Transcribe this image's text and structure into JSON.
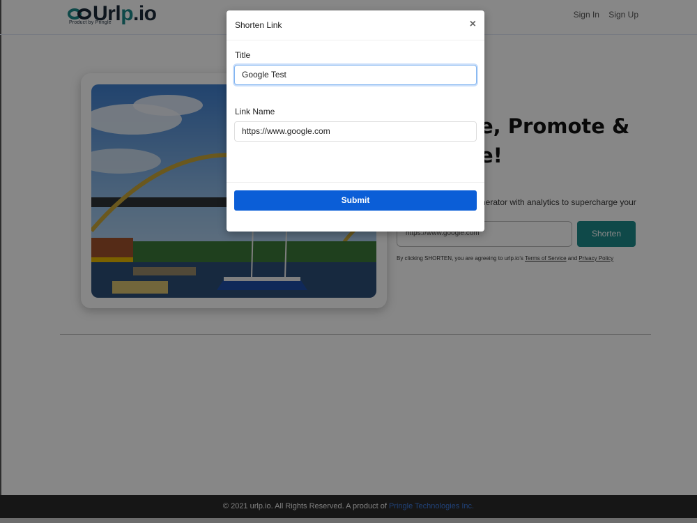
{
  "logo": {
    "name": "Urlp.io",
    "name_main": "Url",
    "name_p": "p",
    "name_tld": ".io",
    "subtitle": "Product by Pringle"
  },
  "nav": {
    "sign_in": "Sign In",
    "sign_up": "Sign Up"
  },
  "hero": {
    "headline_line1": "e, Promote &",
    "headline_line2": "e!",
    "tagline": "nerator with analytics to supercharge your",
    "url_value": "https://www.google.com",
    "shorten_label": "Shorten",
    "legal_prefix": "By clicking SHORTEN, you are agreeing to urlp.io's",
    "terms_label": "Terms of Service",
    "and_label": "and",
    "privacy_label": "Privacy Policy"
  },
  "footer": {
    "text": "© 2021 urlp.io. All Rights Reserved. A product of",
    "link_label": "Pringle Technologies Inc."
  },
  "modal": {
    "title": "Shorten Link",
    "close_symbol": "×",
    "title_label": "Title",
    "title_value": "Google Test",
    "link_label": "Link Name",
    "link_value": "https://www.google.com",
    "submit_label": "Submit"
  },
  "colors": {
    "brand_teal": "#1e8a8a",
    "submit_blue": "#0b5ed7",
    "footer_bg": "#2b2b2b",
    "footer_link": "#3d7be0"
  },
  "icons": {
    "logo_mark": "chain-link-icon",
    "close": "close-icon"
  }
}
